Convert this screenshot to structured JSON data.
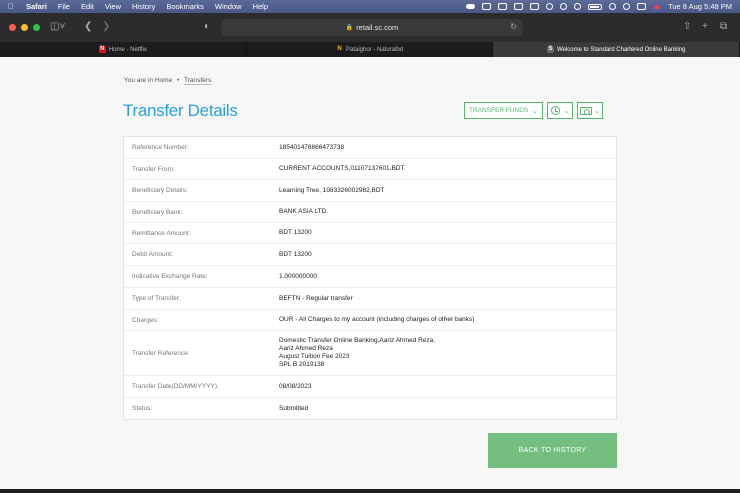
{
  "menubar": {
    "app": "Safari",
    "menus": [
      "File",
      "Edit",
      "View",
      "History",
      "Bookmarks",
      "Window",
      "Help"
    ],
    "clock": "Tue 8 Aug  5:48 PM"
  },
  "browser": {
    "address": "retail.sc.com",
    "tabs": [
      {
        "label": "Home - Netflix",
        "icon": "netflix-icon"
      },
      {
        "label": "Pataighor - Naturalbd",
        "icon": "leaf-icon"
      },
      {
        "label": "Welcome to Standard Chartered Online Banking",
        "icon": "sc-icon",
        "active": true
      }
    ]
  },
  "breadcrumb": {
    "prefix": "You are in",
    "home": "Home",
    "separator": "•",
    "current": "Transfers"
  },
  "page": {
    "title": "Transfer Details",
    "transfer_funds_label": "TRANSFER FUNDS",
    "back_label": "BACK TO HISTORY"
  },
  "details": [
    {
      "label": "Reference Number:",
      "value": "185401478866473738"
    },
    {
      "label": "Transfer From:",
      "value": "CURRENT ACCOUNTS,01107137601,BDT"
    },
    {
      "label": "Beneficiary Details:",
      "value": "Learning Tree, 1083326002982,BDT"
    },
    {
      "label": "Beneficiary Bank:",
      "value": "BANK ASIA LTD."
    },
    {
      "label": "Remittance Amount:",
      "value": "BDT 13200"
    },
    {
      "label": "Debit Amount:",
      "value": "BDT 13200"
    },
    {
      "label": "Indicative Exchange Rate:",
      "value": "1.000000000"
    },
    {
      "label": "Type of Transfer:",
      "value": "BEFTN - Regular transfer"
    },
    {
      "label": "Charges:",
      "value": "OUR - All Charges to my account (including charges of other banks)"
    },
    {
      "label": "Transfer Reference:",
      "value_lines": [
        "Domestic Transfer Online Banking,Aariz Ahmed Reza,",
        "Aariz Ahmed Reza",
        "August Tuition Fee 2023",
        "SPL B 2019138"
      ]
    },
    {
      "label": "Transfer Date(DD/MM/YYYY):",
      "value": "08/08/2023"
    },
    {
      "label": "Status:",
      "value": "Submitted"
    }
  ],
  "colors": {
    "title": "#2d9fd8",
    "accent_green": "#57b46c",
    "button_green": "#74bf7f"
  }
}
